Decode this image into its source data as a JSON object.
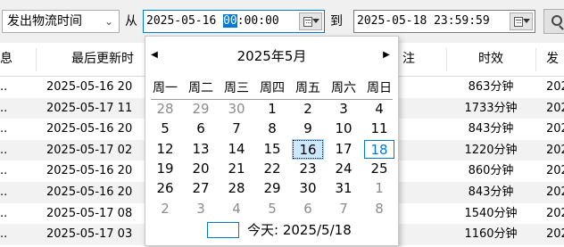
{
  "toolbar": {
    "field_select": {
      "value": "发出物流时间"
    },
    "from_label": "从",
    "start": {
      "date": "2025-05-16",
      "time_hh": "00",
      "time_rest": ":00:00"
    },
    "to_label": "到",
    "end": {
      "value": "2025-05-18 23:59:59"
    }
  },
  "table": {
    "headers": [
      "息",
      "最后更新时",
      "注",
      "时效",
      "发"
    ],
    "rows": [
      {
        "info": "..",
        "updated": "2025-05-16 20",
        "duration": "863分钟",
        "next": "202"
      },
      {
        "info": "..",
        "updated": "2025-05-17 11",
        "duration": "1733分钟",
        "next": "202"
      },
      {
        "info": "..",
        "updated": "2025-05-16 20",
        "duration": "843分钟",
        "next": "202"
      },
      {
        "info": "..",
        "updated": "2025-05-17 02",
        "duration": "1220分钟",
        "next": "202"
      },
      {
        "info": "..",
        "updated": "2025-05-16 20",
        "duration": "860分钟",
        "next": "202"
      },
      {
        "info": "..",
        "updated": "2025-05-16 20",
        "duration": "843分钟",
        "next": "202"
      },
      {
        "info": "..",
        "updated": "2025-05-17 08",
        "duration": "1540分钟",
        "next": "202"
      },
      {
        "info": "..",
        "updated": "2025-05-17 03",
        "duration": "1160分钟",
        "next": "202"
      }
    ]
  },
  "calendar": {
    "title": "2025年5月",
    "weekdays": [
      "周一",
      "周二",
      "周三",
      "周四",
      "周五",
      "周六",
      "周日"
    ],
    "weeks": [
      [
        {
          "d": "28",
          "m": true
        },
        {
          "d": "29",
          "m": true
        },
        {
          "d": "30",
          "m": true
        },
        {
          "d": "1"
        },
        {
          "d": "2"
        },
        {
          "d": "3"
        },
        {
          "d": "4"
        }
      ],
      [
        {
          "d": "5"
        },
        {
          "d": "6"
        },
        {
          "d": "7"
        },
        {
          "d": "8"
        },
        {
          "d": "9"
        },
        {
          "d": "10"
        },
        {
          "d": "11"
        }
      ],
      [
        {
          "d": "12"
        },
        {
          "d": "13"
        },
        {
          "d": "14"
        },
        {
          "d": "15"
        },
        {
          "d": "16",
          "sel": true
        },
        {
          "d": "17"
        },
        {
          "d": "18",
          "today": true
        }
      ],
      [
        {
          "d": "19"
        },
        {
          "d": "20"
        },
        {
          "d": "21"
        },
        {
          "d": "22"
        },
        {
          "d": "23"
        },
        {
          "d": "24"
        },
        {
          "d": "25"
        }
      ],
      [
        {
          "d": "26"
        },
        {
          "d": "27"
        },
        {
          "d": "28"
        },
        {
          "d": "29"
        },
        {
          "d": "30"
        },
        {
          "d": "31"
        },
        {
          "d": "1",
          "m": true
        }
      ],
      [
        {
          "d": "2",
          "m": true
        },
        {
          "d": "3",
          "m": true
        },
        {
          "d": "4",
          "m": true
        },
        {
          "d": "5",
          "m": true
        },
        {
          "d": "6",
          "m": true
        },
        {
          "d": "7",
          "m": true
        },
        {
          "d": "8",
          "m": true
        }
      ]
    ],
    "today_label": "今天: 2025/5/18",
    "prev_icon": "triangle-left-icon",
    "next_icon": "triangle-right-icon"
  },
  "colors": {
    "accent": "#0078d7",
    "selected_bg": "#cce8ff",
    "row_alt": "#f2f2f2"
  }
}
